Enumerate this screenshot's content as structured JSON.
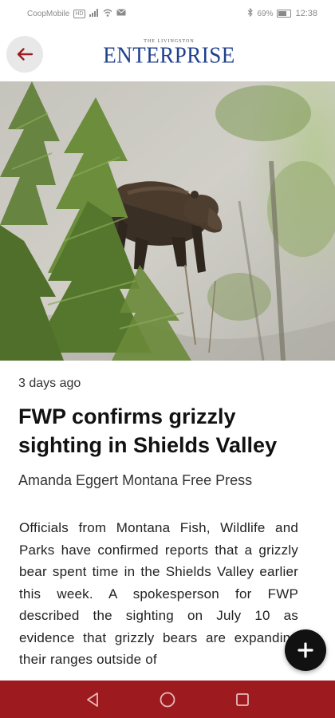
{
  "status_bar": {
    "carrier": "CoopMobile",
    "carrier_badge": "HD",
    "battery": "69%",
    "battery_level": 0.69,
    "time": "12:38",
    "icons": [
      "signal-icon",
      "wifi-icon",
      "mail-icon",
      "bluetooth-icon",
      "battery-icon"
    ]
  },
  "header": {
    "back_icon": "arrow-left-icon",
    "brand_sub": "THE LIVINGSTON",
    "brand_name": "ENTERPRISE",
    "brand_color": "#1f3f8c",
    "back_color": "#9d1a1f"
  },
  "article": {
    "timestamp": "3 days ago",
    "headline": "FWP confirms grizzly sighting in Shields Valley",
    "byline": "Amanda Eggert Montana Free Press",
    "body": "Officials from Montana Fish, Wildlife and Parks have confirmed reports that a grizzly bear spent time in the Shields Valley earlier this week. A spokesperson for FWP described the sighting on July 10 as evidence that grizzly bears are expanding their ranges outside of"
  },
  "fab": {
    "icon": "plus-icon"
  },
  "nav_bar": {
    "color": "#9d1a1f",
    "buttons": [
      "back-triangle-icon",
      "home-circle-icon",
      "recents-square-icon"
    ]
  }
}
